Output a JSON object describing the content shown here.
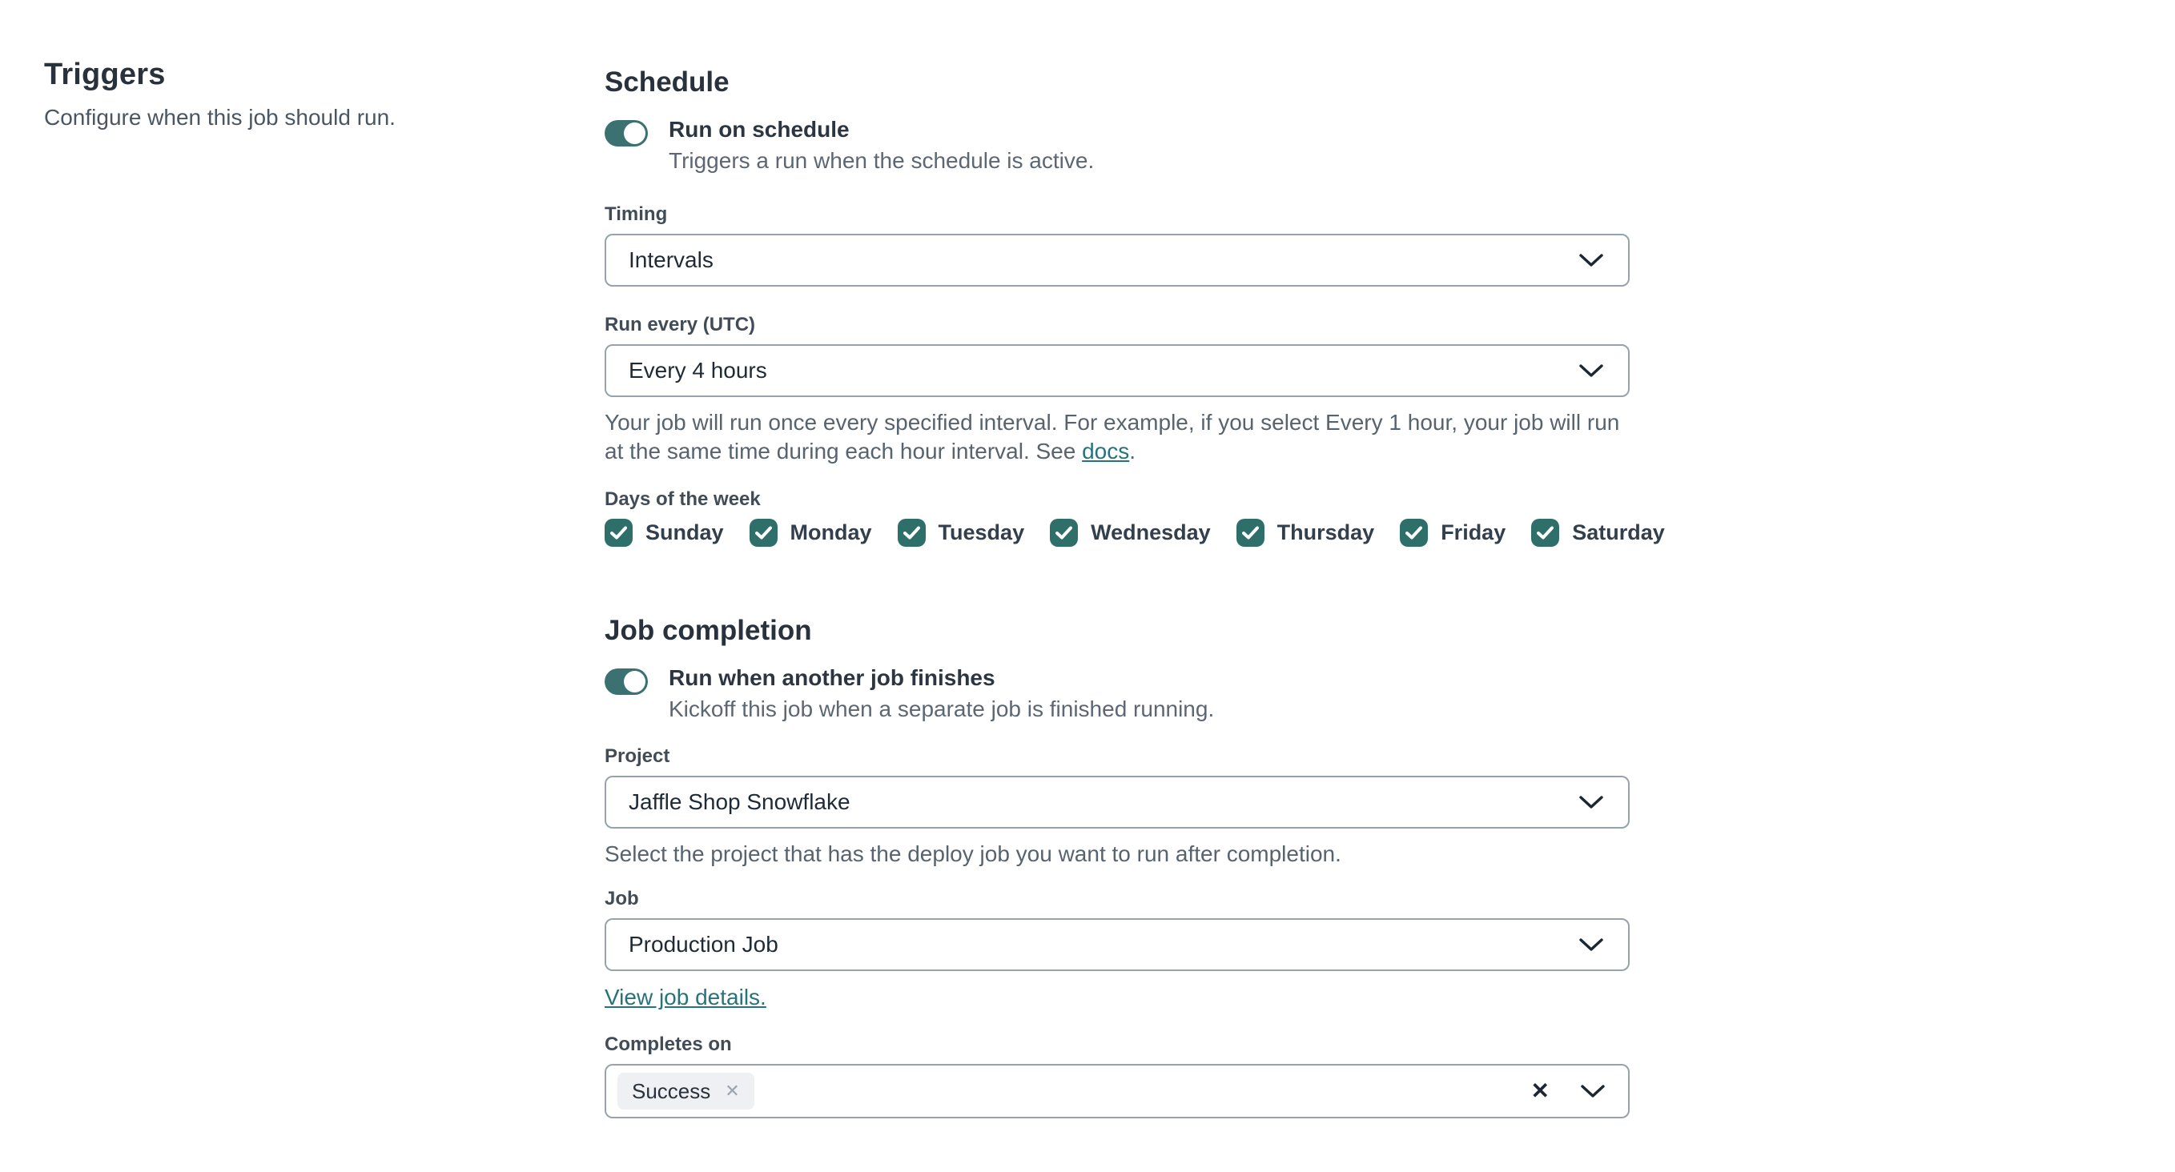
{
  "colors": {
    "toggle_teal": "#3b7170",
    "checkbox_teal": "#2e6f6a",
    "link_teal": "#27737c"
  },
  "icons": {
    "chip_remove": "✕",
    "clear": "✕"
  },
  "sidebar": {
    "title": "Triggers",
    "subtitle": "Configure when this job should run."
  },
  "schedule": {
    "heading": "Schedule",
    "run_on_schedule": {
      "state": "on",
      "label": "Run on schedule",
      "description": "Triggers a run when the schedule is active."
    },
    "timing": {
      "label": "Timing",
      "value": "Intervals"
    },
    "run_every": {
      "label": "Run every (UTC)",
      "value": "Every 4 hours"
    },
    "help": {
      "before": "Your job will run once every specified interval. For example, if you select Every 1 hour, your job will run at the same time during each hour interval. See ",
      "link": "docs",
      "after": "."
    },
    "days": {
      "label": "Days of the week",
      "items": [
        {
          "label": "Sunday",
          "checked": true
        },
        {
          "label": "Monday",
          "checked": true
        },
        {
          "label": "Tuesday",
          "checked": true
        },
        {
          "label": "Wednesday",
          "checked": true
        },
        {
          "label": "Thursday",
          "checked": true
        },
        {
          "label": "Friday",
          "checked": true
        },
        {
          "label": "Saturday",
          "checked": true
        }
      ]
    }
  },
  "job_completion": {
    "heading": "Job completion",
    "run_when_finishes": {
      "state": "on",
      "label": "Run when another job finishes",
      "description": "Kickoff this job when a separate job is finished running."
    },
    "project": {
      "label": "Project",
      "value": "Jaffle Shop Snowflake",
      "help": "Select the project that has the deploy job you want to run after completion."
    },
    "job": {
      "label": "Job",
      "value": "Production Job",
      "link": "View job details."
    },
    "completes_on": {
      "label": "Completes on",
      "chips": [
        "Success"
      ]
    }
  }
}
